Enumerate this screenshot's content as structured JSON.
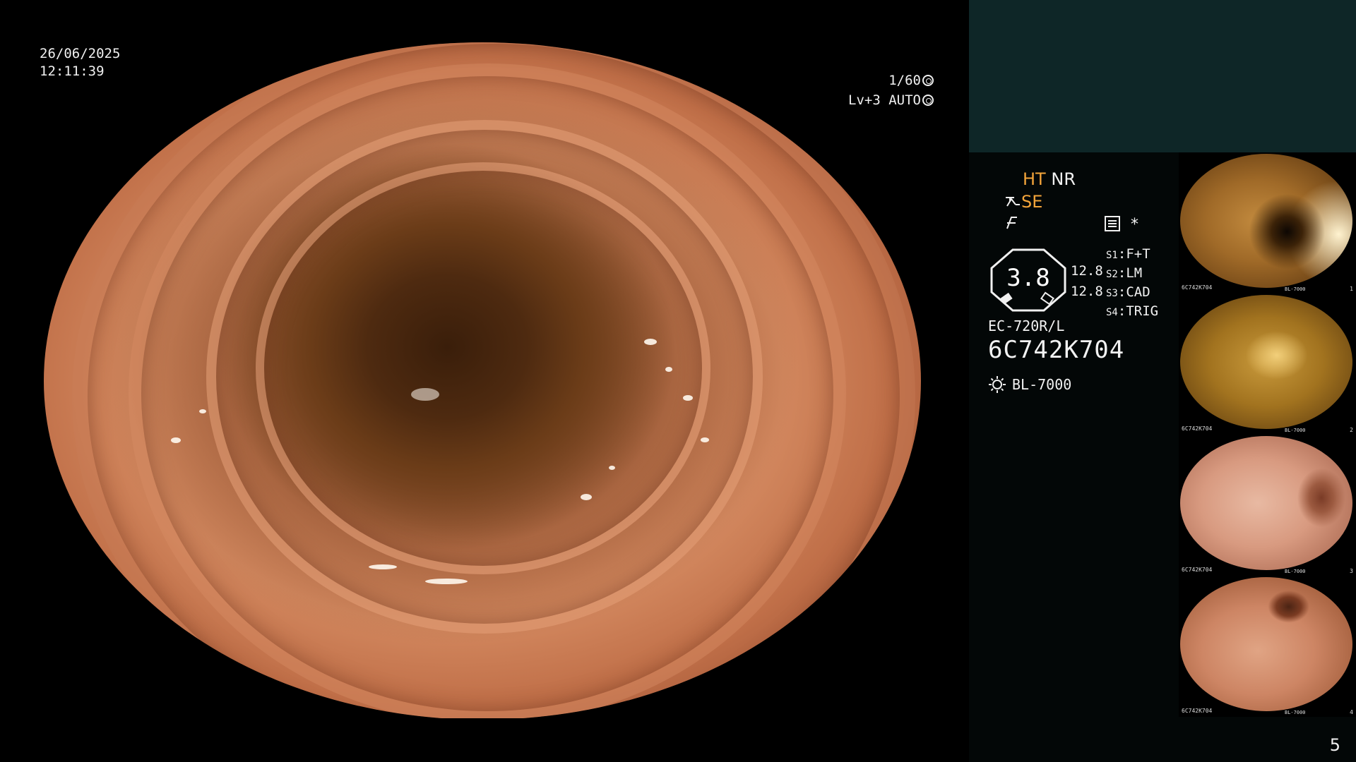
{
  "overlay": {
    "date": "26/06/2025",
    "time": "12:11:39",
    "shutter": "1/60",
    "level": "Lv+3",
    "mode": "AUTO"
  },
  "processor": {
    "ht": "HT",
    "nr": "NR",
    "se": "SE",
    "gauge_value": "3.8",
    "stack_top": "12.8",
    "stack_bottom": "12.8",
    "settings": [
      {
        "key": "S1",
        "value": "F+T"
      },
      {
        "key": "S2",
        "value": "LM"
      },
      {
        "key": "S3",
        "value": "CAD"
      },
      {
        "key": "S4",
        "value": "TRIG"
      }
    ],
    "asterisk": "*",
    "scope_model": "EC-720R/L",
    "scope_serial": "6C742K704",
    "light_source": "BL-7000"
  },
  "thumbnails": [
    {
      "index": "1",
      "serial": "6C742K704",
      "light": "BL-7000",
      "tone": "amber"
    },
    {
      "index": "2",
      "serial": "6C742K704",
      "light": "BL-7000",
      "tone": "golden"
    },
    {
      "index": "3",
      "serial": "6C742K704",
      "light": "BL-7000",
      "tone": "pink"
    },
    {
      "index": "4",
      "serial": "6C742K704",
      "light": "BL-7000",
      "tone": "salmon"
    }
  ],
  "page_number": "5"
}
